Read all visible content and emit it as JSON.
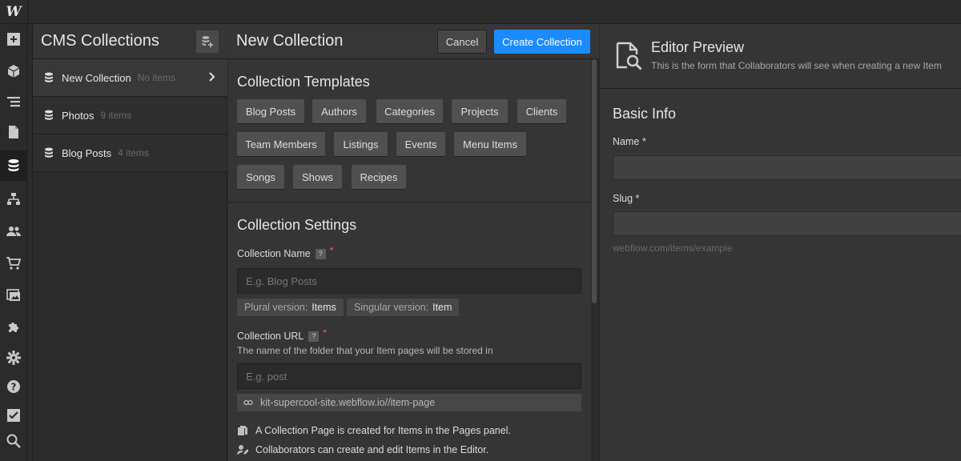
{
  "app": {
    "logo": "W"
  },
  "rail": [
    {
      "icon": "add-panel-icon"
    },
    {
      "icon": "symbols-icon"
    },
    {
      "icon": "navigator-icon"
    },
    {
      "icon": "pages-icon"
    },
    {
      "icon": "cms-icon",
      "active": true
    },
    {
      "icon": "ecommerce-structure-icon"
    },
    {
      "icon": "users-icon"
    },
    {
      "icon": "cart-icon"
    },
    {
      "icon": "assets-icon"
    },
    {
      "icon": "apps-icon"
    },
    {
      "icon": "settings-icon"
    },
    {
      "icon": "help-icon"
    },
    {
      "icon": "audit-icon"
    },
    {
      "icon": "search-icon"
    }
  ],
  "cms": {
    "title": "CMS Collections",
    "collections": [
      {
        "name": "New Collection",
        "count": "No items",
        "selected": true
      },
      {
        "name": "Photos",
        "count": "9 items"
      },
      {
        "name": "Blog Posts",
        "count": "4 items"
      }
    ]
  },
  "new_collection": {
    "title": "New Collection",
    "cancel_label": "Cancel",
    "create_label": "Create Collection",
    "templates_title": "Collection Templates",
    "templates": [
      "Blog Posts",
      "Authors",
      "Categories",
      "Projects",
      "Clients",
      "Team Members",
      "Listings",
      "Events",
      "Menu Items",
      "Songs",
      "Shows",
      "Recipes"
    ],
    "settings_title": "Collection Settings",
    "name_label": "Collection Name",
    "name_placeholder": "E.g. Blog Posts",
    "plural_label": "Plural version:",
    "plural_value": "Items",
    "singular_label": "Singular version:",
    "singular_value": "Item",
    "url_label": "Collection URL",
    "url_help": "The name of the folder that your Item pages will be stored in",
    "url_placeholder": "E.g. post",
    "url_preview": "kit-supercool-site.webflow.io//item-page",
    "info_1": "A Collection Page is created for Items in the Pages panel.",
    "info_2": "Collaborators can create and edit Items in the Editor.",
    "qmark": "?",
    "required": "*"
  },
  "preview": {
    "title": "Editor Preview",
    "subtitle": "This is the form that Collaborators will see when creating a new Item",
    "section_title": "Basic Info",
    "name_label": "Name *",
    "slug_label": "Slug *",
    "slug_hint": "webflow.com/items/example"
  },
  "colors": {
    "accent": "#1a8cff",
    "required": "#ff5a5a",
    "background": "#2b2b2b",
    "panel": "#353535"
  }
}
